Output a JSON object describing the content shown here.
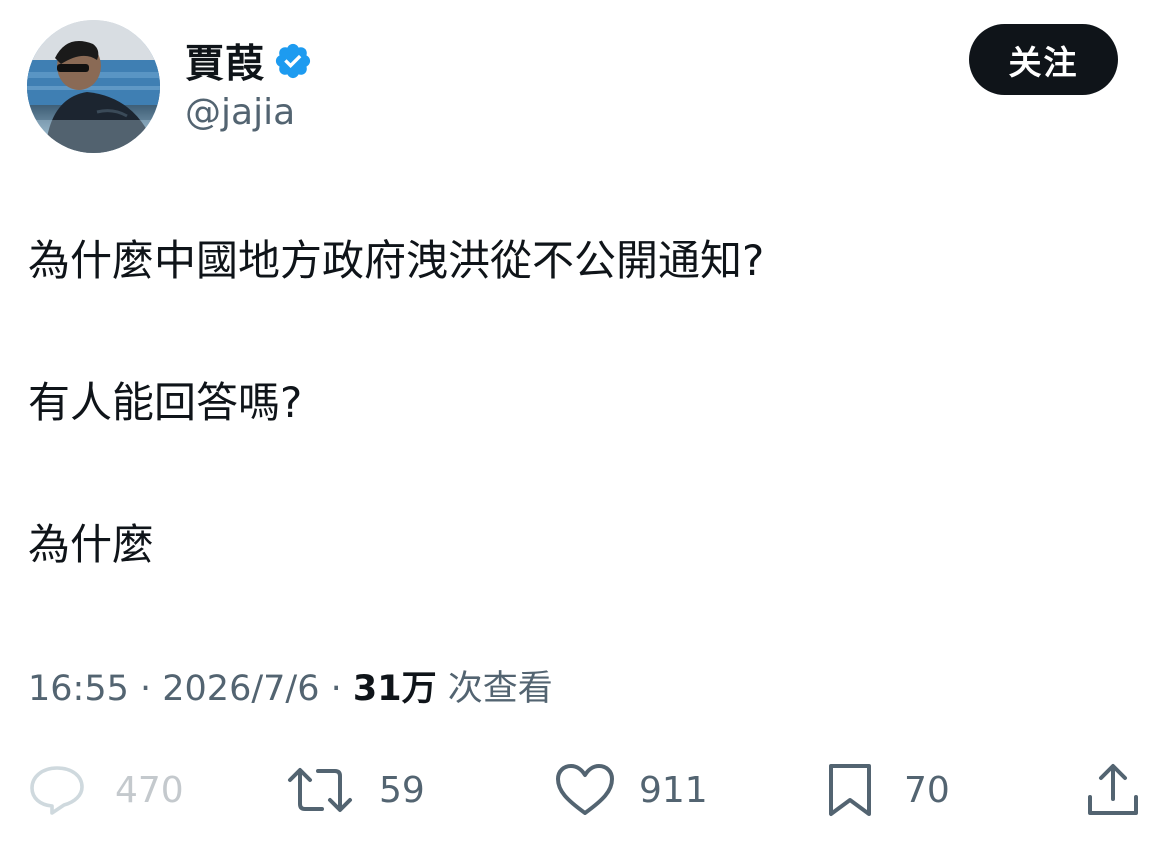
{
  "author": {
    "display_name": "賈葭",
    "handle": "@jajia",
    "verified": true,
    "avatar": "profile-photo"
  },
  "header": {
    "follow_label": "关注"
  },
  "tweet": {
    "lines": [
      "為什麼中國地方政府洩洪從不公開通知?",
      "有人能回答嗎?",
      "為什麼"
    ]
  },
  "meta": {
    "time": "16:55",
    "separator": " · ",
    "date": "2026/7/6",
    "views_count": "31万",
    "views_label": " 次查看"
  },
  "actions": {
    "reply": {
      "icon": "reply-icon",
      "count": "470"
    },
    "retweet": {
      "icon": "retweet-icon",
      "count": "59"
    },
    "like": {
      "icon": "heart-icon",
      "count": "911"
    },
    "bookmark": {
      "icon": "bookmark-icon",
      "count": "70"
    },
    "share": {
      "icon": "share-icon"
    }
  },
  "colors": {
    "text": "#0f1419",
    "secondary": "#536471",
    "verified": "#1d9bf0",
    "button_bg": "#0f1419",
    "muted_reply": "#cfd9de"
  }
}
